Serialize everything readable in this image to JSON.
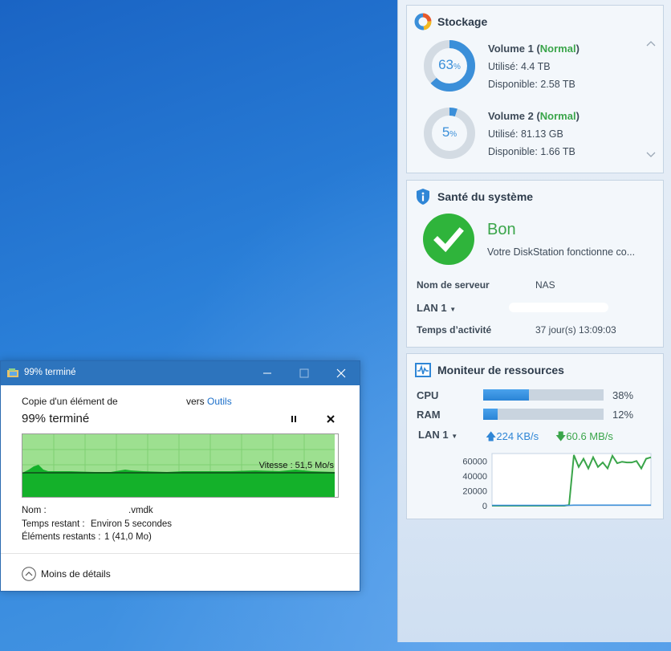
{
  "storage": {
    "title": "Stockage",
    "volumes": [
      {
        "name": "Volume 1",
        "status": "Normal",
        "percent": 63,
        "percent_text": "63",
        "unit": "%",
        "used_label": "Utilisé:",
        "used": "4.4 TB",
        "free_label": "Disponible:",
        "free": "2.58 TB"
      },
      {
        "name": "Volume 2",
        "status": "Normal",
        "percent": 5,
        "percent_text": "5",
        "unit": "%",
        "used_label": "Utilisé:",
        "used": "81.13 GB",
        "free_label": "Disponible:",
        "free": "1.66 TB"
      }
    ],
    "accent": "#3b8fd9",
    "status_color": "#3aa54a"
  },
  "health": {
    "title": "Santé du système",
    "status": "Bon",
    "description": "Votre DiskStation fonctionne co...",
    "server_label": "Nom de serveur",
    "server_value": "NAS",
    "lan_label": "LAN 1",
    "uptime_label": "Temps d’activité",
    "uptime_value": "37 jour(s) 13:09:03"
  },
  "monitor": {
    "title": "Moniteur de ressources",
    "cpu_label": "CPU",
    "cpu_percent": 38,
    "cpu_text": "38%",
    "ram_label": "RAM",
    "ram_percent": 12,
    "ram_text": "12%",
    "lan_label": "LAN 1",
    "upload": "224 KB/s",
    "download": "60.6 MB/s"
  },
  "chart_data": {
    "type": "line",
    "title": "",
    "xlabel": "",
    "ylabel": "",
    "ylim": [
      0,
      70000
    ],
    "ytick_labels": [
      "60000",
      "40000",
      "20000",
      "0"
    ],
    "yticks": [
      60000,
      40000,
      20000,
      0
    ],
    "grid": false,
    "series": [
      {
        "color": "#3aa54a",
        "values": [
          0,
          0,
          0,
          0,
          0,
          0,
          0,
          0,
          0,
          0,
          0,
          0,
          0,
          0,
          0,
          0,
          1000,
          68000,
          52000,
          63000,
          50000,
          65000,
          52000,
          58000,
          50000,
          67000,
          57000,
          59000,
          58000,
          58000,
          60000,
          50000,
          63000,
          65000
        ]
      },
      {
        "color": "#3b8fd9",
        "values": [
          500,
          500,
          500,
          500,
          500,
          500,
          500,
          500,
          500,
          500,
          500,
          500,
          500,
          500,
          500,
          500,
          500,
          800,
          800,
          800,
          800,
          800,
          800,
          800,
          800,
          800,
          800,
          800,
          800,
          800,
          800,
          800,
          800,
          800
        ]
      }
    ]
  },
  "dialog": {
    "title": "99% terminé",
    "copy_prefix": "Copie d'un élément de",
    "copy_vers": "vers",
    "destination": "Outils",
    "progress_text": "99% terminé",
    "progress": 99,
    "speed": "Vitesse : 51,5 Mo/s",
    "name_label": "Nom :",
    "name_value": ".vmdk",
    "remaining_label": "Temps restant :",
    "remaining_value": "Environ 5 secondes",
    "items_label": "Éléments restants :",
    "items_value": "1 (41,0 Mo)",
    "less_details": "Moins de détails"
  }
}
